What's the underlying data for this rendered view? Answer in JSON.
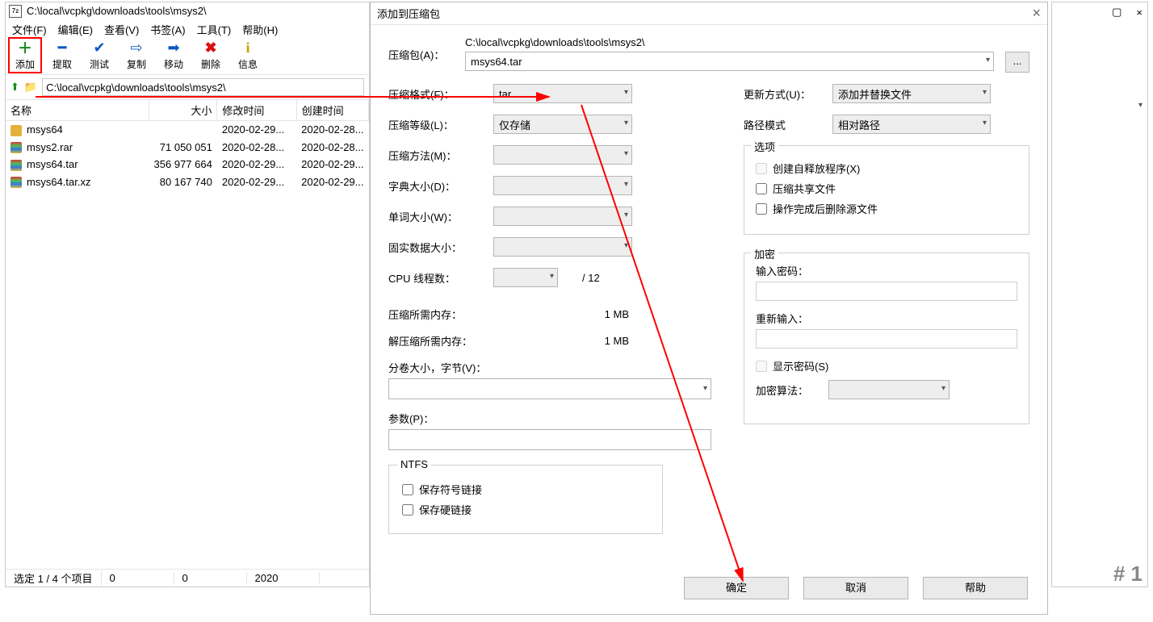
{
  "fm": {
    "title_path": "C:\\local\\vcpkg\\downloads\\tools\\msys2\\",
    "menu": {
      "file": "文件(F)",
      "edit": "编辑(E)",
      "view": "查看(V)",
      "bookmark": "书签(A)",
      "tools": "工具(T)",
      "help": "帮助(H)"
    },
    "toolbar": {
      "add": "添加",
      "extract": "提取",
      "test": "测试",
      "copy": "复制",
      "move": "移动",
      "delete": "删除",
      "info": "信息"
    },
    "path_value": "C:\\local\\vcpkg\\downloads\\tools\\msys2\\",
    "columns": {
      "name": "名称",
      "size": "大小",
      "mtime": "修改时间",
      "ctime": "创建时间"
    },
    "rows": [
      {
        "icon": "fold",
        "name": "msys64",
        "size": "",
        "mtime": "2020-02-29...",
        "ctime": "2020-02-28..."
      },
      {
        "icon": "arch",
        "name": "msys2.rar",
        "size": "71 050 051",
        "mtime": "2020-02-28...",
        "ctime": "2020-02-28..."
      },
      {
        "icon": "arch",
        "name": "msys64.tar",
        "size": "356 977 664",
        "mtime": "2020-02-29...",
        "ctime": "2020-02-29..."
      },
      {
        "icon": "arch",
        "name": "msys64.tar.xz",
        "size": "80 167 740",
        "mtime": "2020-02-29...",
        "ctime": "2020-02-29..."
      }
    ],
    "status": {
      "sel": "选定 1 / 4 个项目",
      "c1": "0",
      "c2": "0",
      "c3": "2020"
    }
  },
  "dlg": {
    "title": "添加到压缩包",
    "archive_path": "C:\\local\\vcpkg\\downloads\\tools\\msys2\\",
    "labels": {
      "archive": "压缩包(A)：",
      "format": "压缩格式(F)：",
      "level": "压缩等级(L)：",
      "method": "压缩方法(M)：",
      "dict": "字典大小(D)：",
      "word": "单词大小(W)：",
      "solid": "固实数据大小：",
      "threads": "CPU 线程数：",
      "mem_c": "压缩所需内存：",
      "mem_d": "解压缩所需内存：",
      "split": "分卷大小，字节(V)：",
      "params": "参数(P)：",
      "update": "更新方式(U)：",
      "pathmode": "路径模式",
      "options": "选项",
      "sfx": "创建自释放程序(X)",
      "share": "压缩共享文件",
      "delsrc": "操作完成后删除源文件",
      "enc": "加密",
      "pw1": "输入密码：",
      "pw2": "重新输入：",
      "showpw": "显示密码(S)",
      "encmethod": "加密算法：",
      "ntfs": "NTFS",
      "symlink": "保存符号链接",
      "hardlink": "保存硬链接"
    },
    "values": {
      "archive_name": "msys64.tar",
      "format": "tar",
      "level": "仅存储",
      "method": "",
      "dict": "",
      "word": "",
      "solid": "",
      "threads": "",
      "threads_max": "/ 12",
      "mem_c": "1 MB",
      "mem_d": "1 MB",
      "update": "添加并替换文件",
      "pathmode": "相对路径",
      "encmethod": ""
    },
    "buttons": {
      "ok": "确定",
      "cancel": "取消",
      "help": "帮助",
      "browse": "..."
    }
  },
  "bgwin": {
    "bottom": "# 1"
  }
}
